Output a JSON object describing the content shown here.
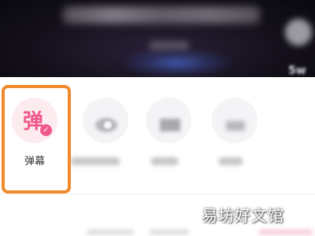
{
  "video": {
    "count_badge": "5w"
  },
  "actions": [
    {
      "label": "弹幕",
      "glyph": "弹",
      "selected": true,
      "badge": "✓"
    },
    {
      "label": "",
      "icon": "eye-icon"
    },
    {
      "label": "",
      "icon": "tv-icon"
    },
    {
      "label": "",
      "icon": "more-icon"
    }
  ],
  "colors": {
    "accent": "#f0588a",
    "highlight_border": "#f08a2c"
  },
  "watermark": "易坊好文馆"
}
